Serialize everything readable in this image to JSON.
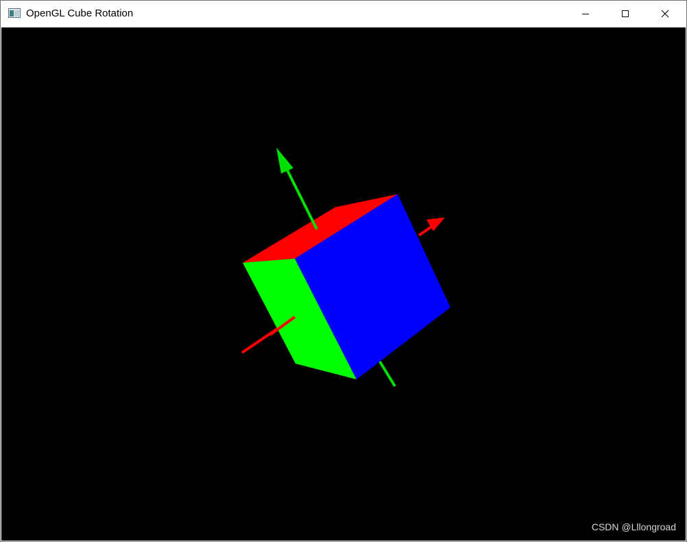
{
  "window": {
    "title": "OpenGL Cube Rotation",
    "app_icon": "window-app-icon"
  },
  "caption_buttons": {
    "minimize_icon": "minimize-icon",
    "maximize_icon": "maximize-icon",
    "close_icon": "close-icon"
  },
  "scene": {
    "background_color": "#000000",
    "cube_faces": [
      {
        "name": "top",
        "color": "#ff0000"
      },
      {
        "name": "left",
        "color": "#00ff00"
      },
      {
        "name": "front",
        "color": "#0000ff"
      }
    ],
    "axes": [
      {
        "name": "y-axis",
        "color": "#00e000"
      },
      {
        "name": "x-axis",
        "color": "#ff0000"
      }
    ]
  },
  "watermark": {
    "text": "CSDN @Lllongroad"
  }
}
